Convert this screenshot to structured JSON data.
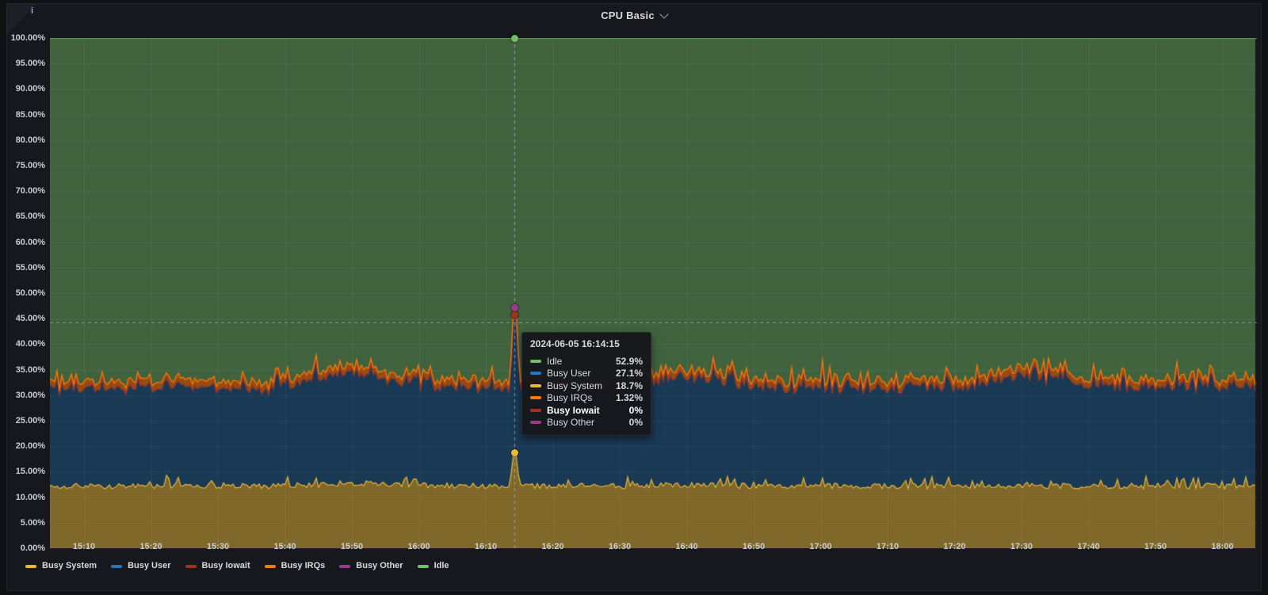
{
  "panel": {
    "title": "CPU Basic",
    "title_chevron_icon": "chevron-down",
    "corner_info_icon": "i"
  },
  "colors": {
    "Busy System": "#EAB839",
    "Busy User": "#1F78C1",
    "Busy Iowait": "#A0321C",
    "Busy IRQs": "#FF780A",
    "Busy Other": "#963B8E",
    "Idle": "#73BF69",
    "grid": "rgba(255,255,255,0.08)",
    "crosshair": "rgba(160,190,220,0.7)",
    "axis_text": "#c8ccd3"
  },
  "y_axis": {
    "unit": "%",
    "min": 0,
    "max": 100,
    "step": 5,
    "labels": [
      "100.00%",
      "95.00%",
      "90.00%",
      "85.00%",
      "80.00%",
      "75.00%",
      "70.00%",
      "65.00%",
      "60.00%",
      "55.00%",
      "50.00%",
      "45.00%",
      "40.00%",
      "35.00%",
      "30.00%",
      "25.00%",
      "20.00%",
      "15.00%",
      "10.00%",
      "5.00%",
      "0.00%"
    ]
  },
  "x_axis": {
    "tick_interval": "10m",
    "labels": [
      "15:10",
      "15:20",
      "15:30",
      "15:40",
      "15:50",
      "16:00",
      "16:10",
      "16:20",
      "16:30",
      "16:40",
      "16:50",
      "17:00",
      "17:10",
      "17:20",
      "17:30",
      "17:40",
      "17:50",
      "18:00"
    ]
  },
  "chart_data": {
    "type": "area",
    "stacked": true,
    "title": "CPU Basic",
    "ylim": [
      0,
      100
    ],
    "grid": true,
    "legend_position": "bottom",
    "categories": [
      "15:10",
      "15:20",
      "15:30",
      "15:40",
      "15:50",
      "16:00",
      "16:10",
      "16:20",
      "16:30",
      "16:40",
      "16:50",
      "17:00",
      "17:10",
      "17:20",
      "17:30",
      "17:40",
      "17:50",
      "18:00"
    ],
    "series": [
      {
        "name": "Busy System",
        "values": [
          12.2,
          12.2,
          12.2,
          12.2,
          12.8,
          12.3,
          12.2,
          12.2,
          12.2,
          12.4,
          12.2,
          12.2,
          12.2,
          12.2,
          12.3,
          12.2,
          12.2,
          12.2
        ]
      },
      {
        "name": "Busy User",
        "values": [
          19.2,
          19.2,
          19.2,
          19.3,
          22.0,
          19.5,
          19.2,
          19.2,
          19.3,
          21.5,
          19.4,
          19.2,
          19.2,
          19.3,
          21.8,
          20.0,
          19.2,
          19.4
        ]
      },
      {
        "name": "Busy Iowait",
        "values": [
          0,
          0,
          0,
          0,
          0,
          0,
          0,
          0,
          0,
          0,
          0,
          0,
          0,
          0,
          0,
          0,
          0,
          0
        ]
      },
      {
        "name": "Busy IRQs",
        "values": [
          1.3,
          1.3,
          1.3,
          1.3,
          1.3,
          1.3,
          1.3,
          1.3,
          1.3,
          1.3,
          1.3,
          1.3,
          1.3,
          1.3,
          1.3,
          1.3,
          1.3,
          1.3
        ]
      },
      {
        "name": "Busy Other",
        "values": [
          0,
          0,
          0,
          0,
          0,
          0,
          0,
          0,
          0,
          0,
          0,
          0,
          0,
          0,
          0,
          0,
          0,
          0
        ]
      },
      {
        "name": "Idle",
        "values": [
          67.3,
          67.3,
          67.3,
          67.2,
          63.9,
          66.9,
          67.3,
          67.3,
          67.2,
          64.8,
          67.1,
          67.3,
          67.3,
          67.2,
          64.6,
          66.5,
          67.3,
          67.1
        ]
      }
    ],
    "jitter": {
      "Busy System": 0.9,
      "Busy User": 1.4,
      "Busy IRQs": 0.3
    },
    "highlight": {
      "timestamp": "2024-06-05 16:14:15",
      "time_label": "16:14:15",
      "cursor_y_percent": 44.2,
      "values": {
        "Busy System": 18.7,
        "Busy User": 27.1,
        "Busy Iowait": 0,
        "Busy IRQs": 1.32,
        "Busy Other": 0,
        "Idle": 52.9
      }
    }
  },
  "tooltip": {
    "timestamp": "2024-06-05 16:14:15",
    "rows": [
      {
        "label": "Idle",
        "value": "52.9%",
        "bold": false
      },
      {
        "label": "Busy User",
        "value": "27.1%",
        "bold": false
      },
      {
        "label": "Busy System",
        "value": "18.7%",
        "bold": false
      },
      {
        "label": "Busy IRQs",
        "value": "1.32%",
        "bold": false
      },
      {
        "label": "Busy Iowait",
        "value": "0%",
        "bold": true
      },
      {
        "label": "Busy Other",
        "value": "0%",
        "bold": false
      }
    ]
  },
  "legend": {
    "items": [
      "Busy System",
      "Busy User",
      "Busy Iowait",
      "Busy IRQs",
      "Busy Other",
      "Idle"
    ]
  }
}
